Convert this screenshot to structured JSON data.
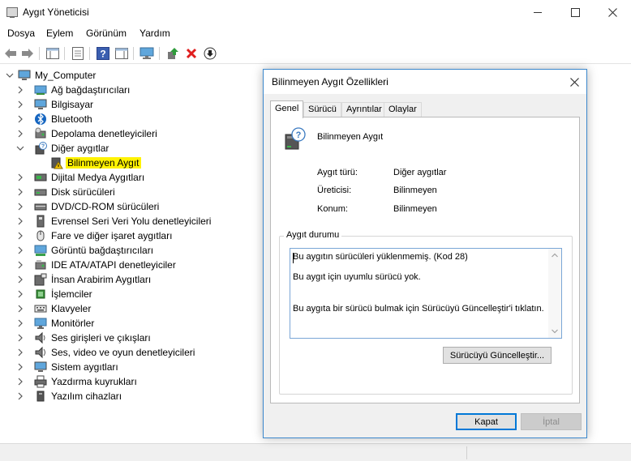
{
  "window": {
    "title": "Aygıt Yöneticisi"
  },
  "menu": [
    {
      "label": "Dosya"
    },
    {
      "label": "Eylem"
    },
    {
      "label": "Görünüm"
    },
    {
      "label": "Yardım"
    }
  ],
  "tree": {
    "root": "My_Computer",
    "items": [
      {
        "label": "Ağ bağdaştırıcıları",
        "icon": "network-adapter-icon"
      },
      {
        "label": "Bilgisayar",
        "icon": "computer-icon"
      },
      {
        "label": "Bluetooth",
        "icon": "bluetooth-icon"
      },
      {
        "label": "Depolama denetleyicileri",
        "icon": "storage-controller-icon"
      },
      {
        "label": "Diğer aygıtlar",
        "icon": "other-devices-icon"
      },
      {
        "label": "Bilinmeyen Aygıt",
        "icon": "unknown-device-warning-icon"
      },
      {
        "label": "Dijital Medya Aygıtları",
        "icon": "digital-media-icon"
      },
      {
        "label": "Disk sürücüleri",
        "icon": "disk-drive-icon"
      },
      {
        "label": "DVD/CD-ROM sürücüleri",
        "icon": "dvd-drive-icon"
      },
      {
        "label": "Evrensel Seri Veri Yolu denetleyicileri",
        "icon": "usb-controller-icon"
      },
      {
        "label": "Fare ve diğer işaret aygıtları",
        "icon": "mouse-icon"
      },
      {
        "label": "Görüntü bağdaştırıcıları",
        "icon": "display-adapter-icon"
      },
      {
        "label": "IDE ATA/ATAPI denetleyiciler",
        "icon": "ide-controller-icon"
      },
      {
        "label": "İnsan Arabirim Aygıtları",
        "icon": "hid-icon"
      },
      {
        "label": "İşlemciler",
        "icon": "processor-icon"
      },
      {
        "label": "Klavyeler",
        "icon": "keyboard-icon"
      },
      {
        "label": "Monitörler",
        "icon": "monitor-icon"
      },
      {
        "label": "Ses girişleri ve çıkışları",
        "icon": "audio-io-icon"
      },
      {
        "label": "Ses, video ve oyun denetleyicileri",
        "icon": "sound-video-icon"
      },
      {
        "label": "Sistem aygıtları",
        "icon": "system-devices-icon"
      },
      {
        "label": "Yazdırma kuyrukları",
        "icon": "printer-icon"
      },
      {
        "label": "Yazılım cihazları",
        "icon": "software-device-icon"
      }
    ]
  },
  "dialog": {
    "title": "Bilinmeyen Aygıt Özellikleri",
    "tabs": [
      {
        "label": "Genel"
      },
      {
        "label": "Sürücü"
      },
      {
        "label": "Ayrıntılar"
      },
      {
        "label": "Olaylar"
      }
    ],
    "device_name": "Bilinmeyen Aygıt",
    "properties": [
      {
        "label": "Aygıt türü:",
        "value": "Diğer aygıtlar"
      },
      {
        "label": "Üreticisi:",
        "value": "Bilinmeyen"
      },
      {
        "label": "Konum:",
        "value": "Bilinmeyen"
      }
    ],
    "status_group_title": "Aygıt durumu",
    "status_lines": [
      "Bu aygıtın sürücüleri yüklenmemiş. (Kod 28)",
      "Bu aygıt için uyumlu sürücü yok.",
      "Bu aygıta bir sürücü bulmak için Sürücüyü Güncelleştir'i tıklatın."
    ],
    "update_button": "Sürücüyü Güncelleştir...",
    "ok_button": "Kapat",
    "cancel_button": "İptal"
  },
  "colors": {
    "accent": "#0078d7",
    "highlight": "#fff200",
    "dialog_border": "#3b87cc"
  }
}
